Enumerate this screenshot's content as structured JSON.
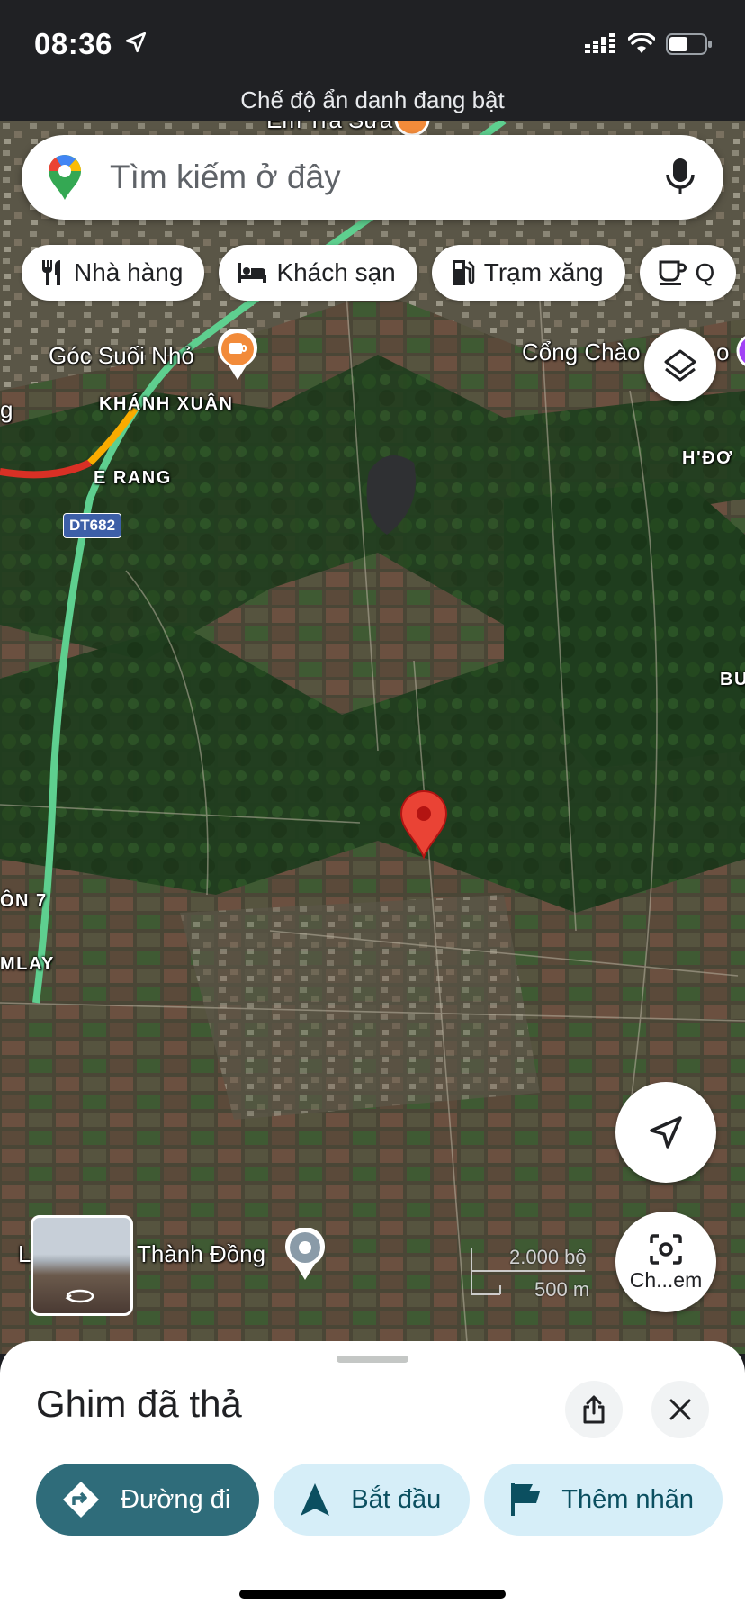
{
  "status_bar": {
    "time": "08:36",
    "incognito_text": "Chế độ ẩn danh đang bật"
  },
  "search": {
    "placeholder": "Tìm kiếm ở đây"
  },
  "chips": [
    {
      "label": "Nhà hàng",
      "icon": "restaurant-icon"
    },
    {
      "label": "Khách sạn",
      "icon": "hotel-icon"
    },
    {
      "label": "Trạm xăng",
      "icon": "gas-station-icon"
    },
    {
      "label": "Q",
      "icon": "coffee-icon"
    }
  ],
  "map": {
    "labels": {
      "top_place": "Ém Trà Sữa",
      "goc_suoi_nho": "Góc Suối Nhỏ",
      "khanh_xuan": "KHÁNH XUÂN",
      "cong_chao": "Cổng Chào",
      "cong_chao_suffix": "o",
      "h_don": "H'ĐƠ",
      "e_rang": "E RANG",
      "road_badge": "DT682",
      "bu": "BU",
      "thon7": "ÔN 7",
      "mlay": "MLAY",
      "thanh_dong": "Thành Đồng",
      "thanh_dong_prefix": "L",
      "g": "g"
    },
    "scale": {
      "feet": "2.000 bộ",
      "meters": "500 m"
    },
    "lens_label": "Ch...em",
    "colors": {
      "pin": "#ea4335",
      "highway": "#5ecf8f",
      "traffic_red": "#d93025"
    }
  },
  "sheet": {
    "title": "Ghim đã thả",
    "actions": [
      {
        "label": "Đường đi",
        "icon": "directions-icon"
      },
      {
        "label": "Bắt đầu",
        "icon": "navigation-icon"
      },
      {
        "label": "Thêm nhãn",
        "icon": "flag-icon"
      }
    ]
  }
}
